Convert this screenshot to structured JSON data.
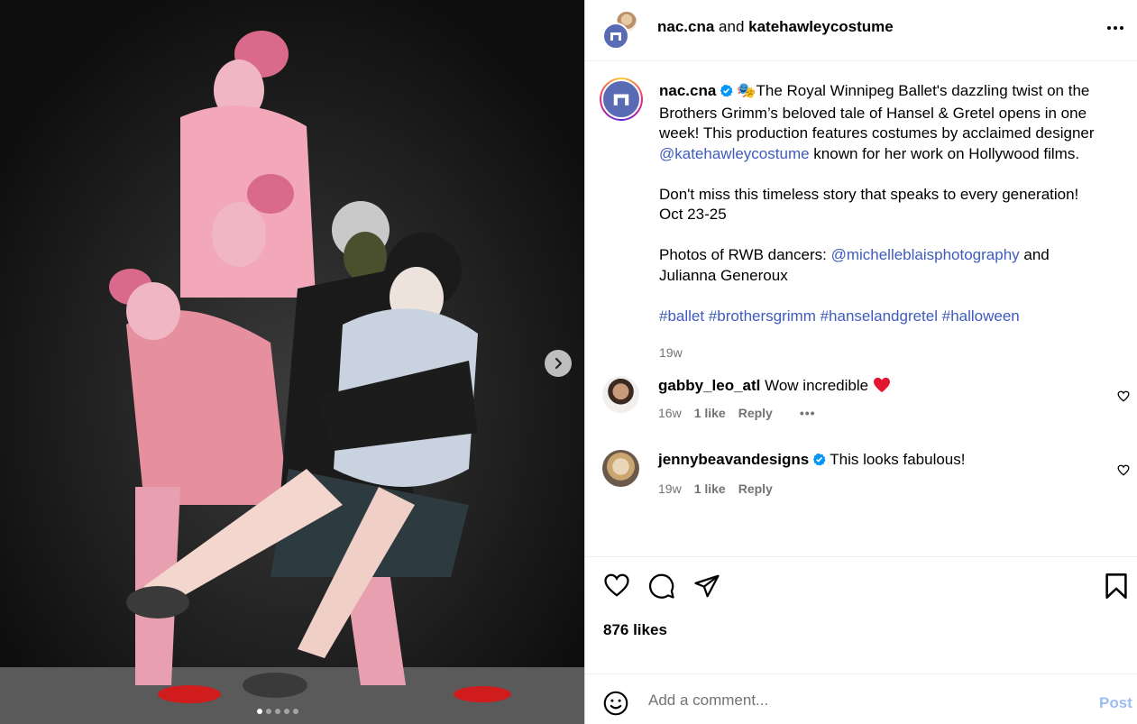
{
  "header": {
    "account1": "nac.cna",
    "joiner": " and ",
    "account2": "katehawleycostume"
  },
  "caption": {
    "username": "nac.cna",
    "emoji": "🎭",
    "line1": "The Royal Winnipeg Ballet's dazzling twist on the Brothers Grimm’s beloved tale of Hansel & Gretel opens in one week! This production features costumes by acclaimed designer ",
    "mention1": "@katehawleycostume",
    "line1_end": " known for her work on Hollywood films.",
    "para2": "Don't miss this timeless story that speaks to every generation!",
    "para2b": "Oct 23-25",
    "para3_start": "Photos of RWB dancers: ",
    "mention2": "@michelleblaisphotography",
    "para3_end": " and Julianna Generoux",
    "hashtags": "#ballet #brothersgrimm #hanselandgretel #halloween",
    "time": "19w"
  },
  "comments": [
    {
      "username": "gabby_leo_atl",
      "text": "Wow incredible",
      "time": "16w",
      "likes": "1 like",
      "reply": "Reply",
      "more": "•••"
    },
    {
      "username": "jennybeavandesigns",
      "text": "This looks fabulous!",
      "time": "19w",
      "likes": "1 like",
      "reply": "Reply"
    }
  ],
  "likes": "876 likes",
  "comment_box": {
    "placeholder": "Add a comment...",
    "post_label": "Post"
  },
  "carousel": {
    "slide_count": 5,
    "active_slide": 1
  },
  "colors": {
    "link": "#3f5bbd",
    "verified": "#0095f6",
    "post_disabled": "#9fbcf5",
    "heart": "#ff3040"
  }
}
